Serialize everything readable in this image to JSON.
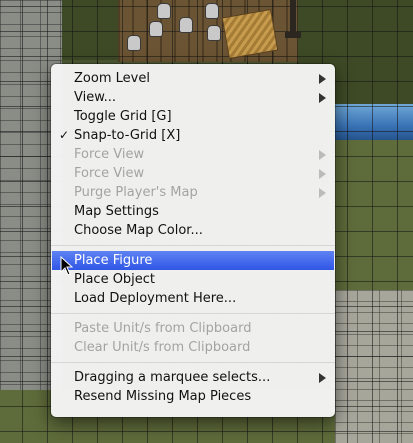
{
  "menu": {
    "items": [
      {
        "label": "Zoom Level",
        "enabled": true,
        "submenu": true,
        "checked": false
      },
      {
        "label": "View...",
        "enabled": true,
        "submenu": true,
        "checked": false
      },
      {
        "label": "Toggle Grid [G]",
        "enabled": true,
        "submenu": false,
        "checked": false
      },
      {
        "label": "Snap-to-Grid [X]",
        "enabled": true,
        "submenu": false,
        "checked": true
      },
      {
        "label": "Force View",
        "enabled": false,
        "submenu": true,
        "checked": false
      },
      {
        "label": "Force View",
        "enabled": false,
        "submenu": true,
        "checked": false
      },
      {
        "label": "Purge Player's Map",
        "enabled": false,
        "submenu": true,
        "checked": false
      },
      {
        "label": "Map Settings",
        "enabled": true,
        "submenu": false,
        "checked": false
      },
      {
        "label": "Choose Map Color...",
        "enabled": true,
        "submenu": false,
        "checked": false
      },
      {
        "label": "Place Figure",
        "enabled": true,
        "submenu": false,
        "checked": false,
        "selected": true
      },
      {
        "label": "Place Object",
        "enabled": true,
        "submenu": false,
        "checked": false
      },
      {
        "label": "Load Deployment Here...",
        "enabled": true,
        "submenu": false,
        "checked": false
      },
      {
        "label": "Paste Unit/s from Clipboard",
        "enabled": false,
        "submenu": false,
        "checked": false
      },
      {
        "label": "Clear Unit/s from Clipboard",
        "enabled": false,
        "submenu": false,
        "checked": false
      },
      {
        "label": "Dragging a marquee selects...",
        "enabled": true,
        "submenu": true,
        "checked": false
      },
      {
        "label": "Resend Missing Map Pieces",
        "enabled": true,
        "submenu": false,
        "checked": false
      }
    ],
    "check_glyph": "✓"
  },
  "colors": {
    "selection": "#2f56e6",
    "disabled_text": "#a3a3a3",
    "menu_bg": "#f5f5f5"
  },
  "icons": {
    "checkmark": "checkmark-icon",
    "submenu_arrow": "chevron-right-icon",
    "cursor": "pointer-cursor-icon"
  }
}
